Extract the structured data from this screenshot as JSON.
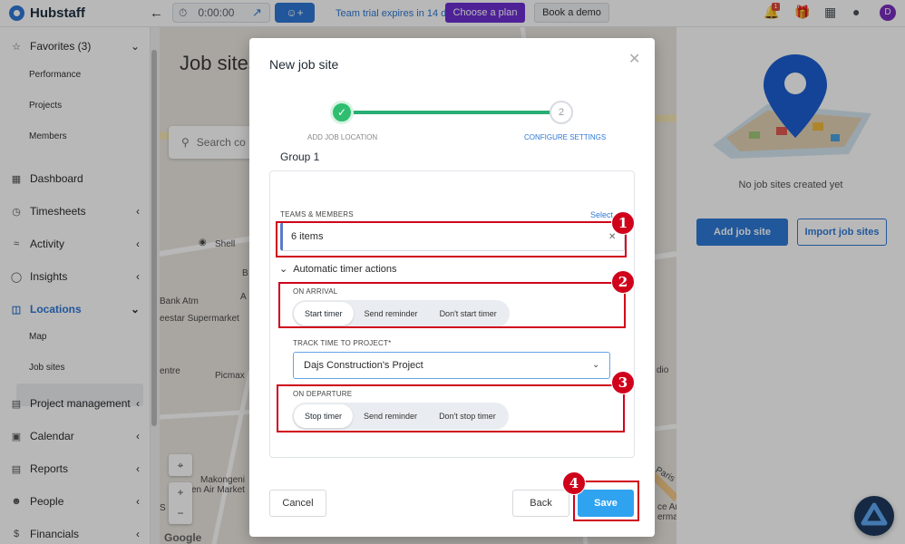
{
  "app": {
    "name": "Hubstaff"
  },
  "topbar": {
    "timer": "0:00:00",
    "trial_text": "Team trial expires in 14 days.",
    "choose_plan": "Choose a plan",
    "book_demo": "Book a demo",
    "notification_count": "1",
    "avatar_initial": "D"
  },
  "sidebar": {
    "favorites": "Favorites (3)",
    "fav_items": [
      "Performance",
      "Projects",
      "Members"
    ],
    "items": {
      "dashboard": "Dashboard",
      "timesheets": "Timesheets",
      "activity": "Activity",
      "insights": "Insights",
      "locations": "Locations",
      "project_management": "Project management",
      "calendar": "Calendar",
      "reports": "Reports",
      "people": "People",
      "financials": "Financials"
    },
    "location_sub": [
      "Map",
      "Job sites"
    ]
  },
  "page": {
    "title": "Job sites",
    "search_placeholder": "Search co",
    "map_labels": [
      "Shell",
      "Bank Atm",
      "eestar Supermarket",
      "Picmax",
      "entre",
      "Makongeni",
      "en Air Market",
      "dio",
      "Paris",
      "ce And",
      "ermarket",
      "S",
      "B",
      "A"
    ],
    "google": "Google"
  },
  "right_panel": {
    "empty_text": "No job sites created yet",
    "add_button": "Add job site",
    "import_button": "Import job sites"
  },
  "modal": {
    "title": "New job site",
    "step1_label": "ADD JOB LOCATION",
    "step2_label": "CONFIGURE SETTINGS",
    "step2_number": "2",
    "group_title": "Group 1",
    "teams_label": "TEAMS & MEMBERS",
    "select_link": "Select",
    "members_value": "6 items",
    "auto_actions": "Automatic timer actions",
    "arrival_label": "ON ARRIVAL",
    "arrival_options": [
      "Start timer",
      "Send reminder",
      "Don't start timer"
    ],
    "track_label": "TRACK TIME TO PROJECT*",
    "project_value": "Dajs Construction's Project",
    "departure_label": "ON DEPARTURE",
    "departure_options": [
      "Stop timer",
      "Send reminder",
      "Don't stop timer"
    ],
    "cancel": "Cancel",
    "back": "Back",
    "save": "Save"
  },
  "annotations": [
    "1",
    "2",
    "3",
    "4"
  ],
  "colors": {
    "accent": "#2e78d6",
    "plan": "#6c2fd2",
    "success": "#2fbd6f",
    "save": "#2fa3f0",
    "highlight": "#d0021b"
  }
}
